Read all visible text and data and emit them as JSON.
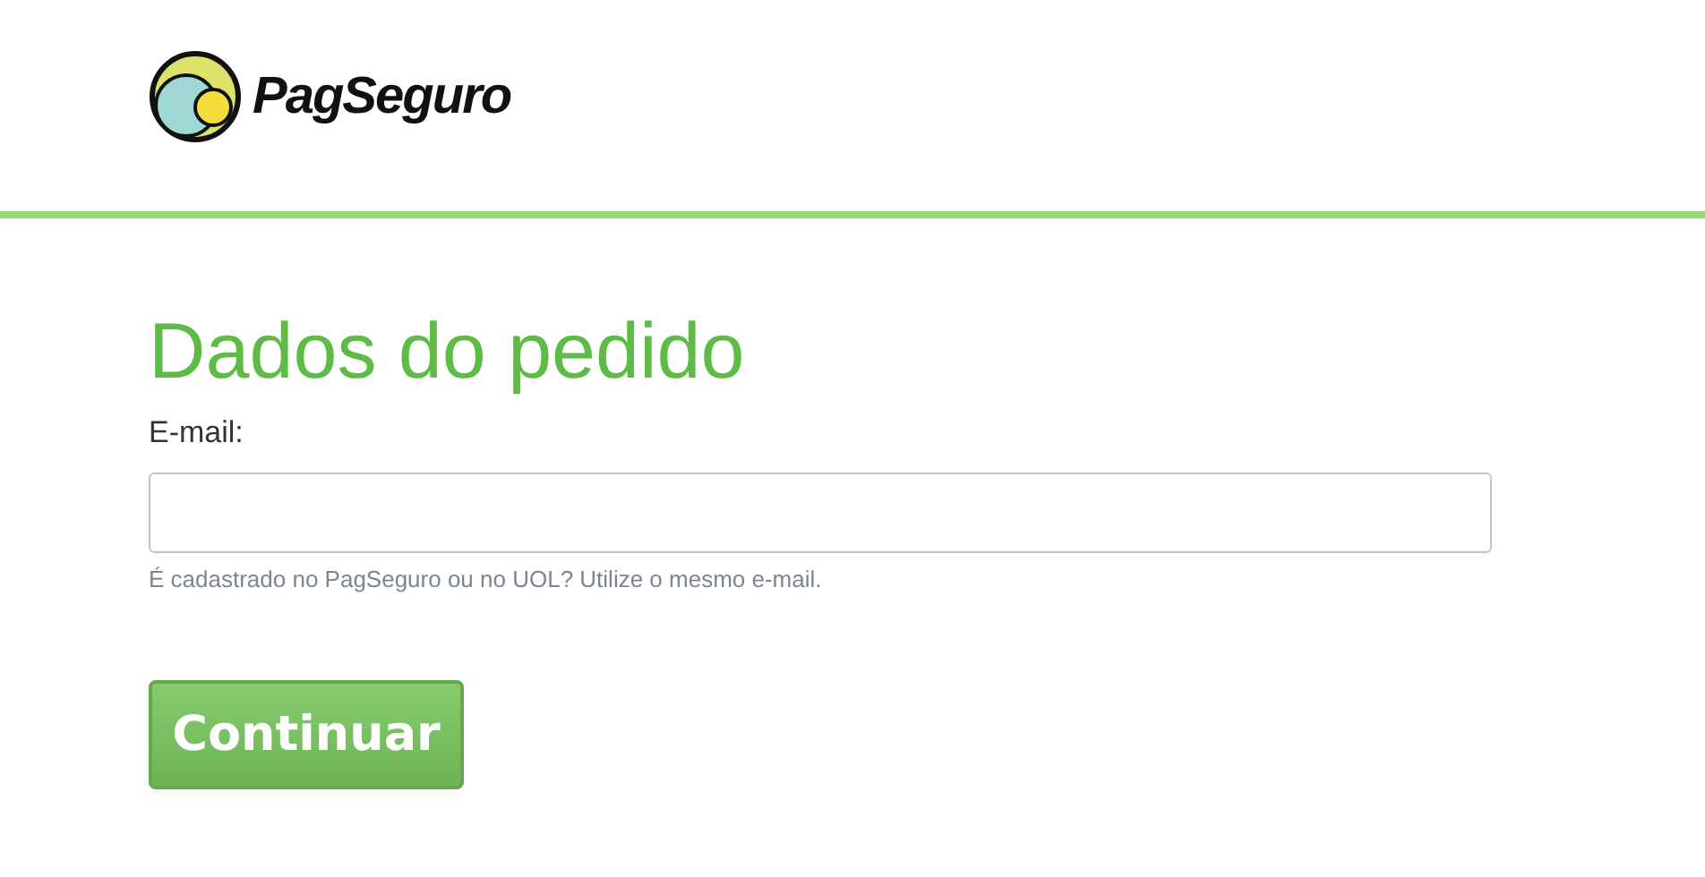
{
  "header": {
    "brand": "PagSeguro"
  },
  "form": {
    "title": "Dados do pedido",
    "email_label": "E-mail:",
    "email_hint": "É cadastrado no PagSeguro ou no UOL? Utilize o mesmo e-mail.",
    "submit": "Continuar"
  }
}
